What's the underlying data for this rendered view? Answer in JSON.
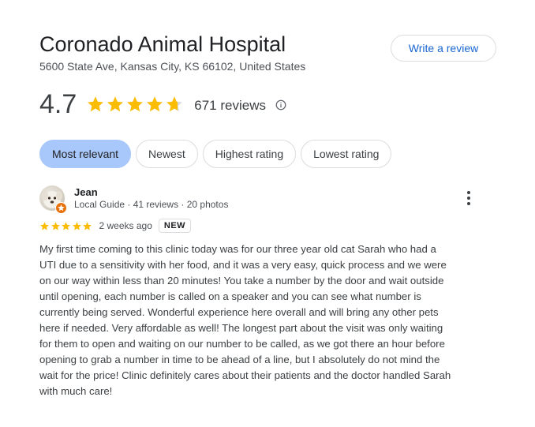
{
  "header": {
    "title": "Coronado Animal Hospital",
    "address": "5600 State Ave, Kansas City, KS 66102, United States",
    "write_review_label": "Write a review"
  },
  "rating": {
    "value": "4.7",
    "stars": 4.7,
    "count_label": "671 reviews",
    "info_icon": "info-icon",
    "star_color": "#fbbc04"
  },
  "sort_chips": [
    {
      "label": "Most relevant",
      "active": true
    },
    {
      "label": "Newest",
      "active": false
    },
    {
      "label": "Highest rating",
      "active": false
    },
    {
      "label": "Lowest rating",
      "active": false
    }
  ],
  "review": {
    "reviewer_name": "Jean",
    "reviewer_meta": "Local Guide · 41 reviews · 20 photos",
    "stars": 5,
    "date": "2 weeks ago",
    "badge": "NEW",
    "more_icon": "more-vert-icon",
    "lines": [
      "My first time coming to this clinic today was for our three year old cat Sarah who had a",
      "UTI due to a sensitivity with her food, and it was a very easy, quick process and we were",
      "on our way within less than 20 minutes! You take a number by the door and wait outside",
      "until opening, each number is called on a speaker and you can see what number is",
      "currently being served. Wonderful experience here overall and will bring any other pets",
      "here if needed. Very affordable as well! The longest part about the visit was only waiting",
      "for them to open and waiting on our number to be called, as we got there an hour before",
      "opening to grab a number in time to be ahead of a line, but I absolutely do not mind the",
      "wait for the price! Clinic definitely cares about their patients and the doctor handled Sarah",
      "with much care!"
    ]
  },
  "colors": {
    "accent_chip": "#a8c7fa",
    "link_blue": "#1967d2",
    "local_guide_badge": "#e8710a"
  }
}
